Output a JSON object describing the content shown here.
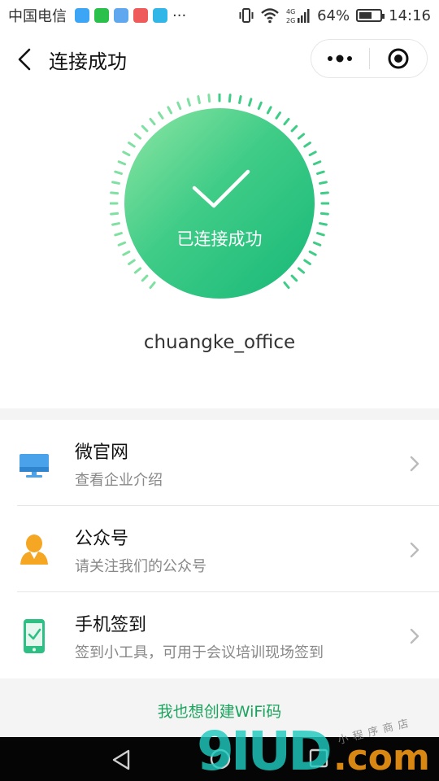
{
  "status_bar": {
    "carrier": "中国电信",
    "more_apps": "···",
    "network_label": "4G\n2G",
    "battery": "64%",
    "battery_level": 0.64,
    "time": "14:16"
  },
  "header": {
    "title": "连接成功"
  },
  "success": {
    "text": "已连接成功",
    "ssid": "chuangke_office"
  },
  "list": {
    "items": [
      {
        "title": "微官网",
        "subtitle": "查看企业介绍",
        "icon": "monitor-icon"
      },
      {
        "title": "公众号",
        "subtitle": "请关注我们的公众号",
        "icon": "person-icon"
      },
      {
        "title": "手机签到",
        "subtitle": "签到小工具，可用于会议培训现场签到",
        "icon": "phone-check-icon"
      }
    ]
  },
  "footer": {
    "create_link": "我也想创建WiFi码"
  },
  "watermark": {
    "main": "9IUD",
    "com": ".com",
    "small": "小程序商店"
  },
  "colors": {
    "accent_green": "#1aa35d",
    "circle_start": "#8fe6a4",
    "circle_end": "#18b878",
    "monitor_blue": "#3b8fd9",
    "person_orange": "#f5a623",
    "phone_green": "#2dbf83"
  }
}
